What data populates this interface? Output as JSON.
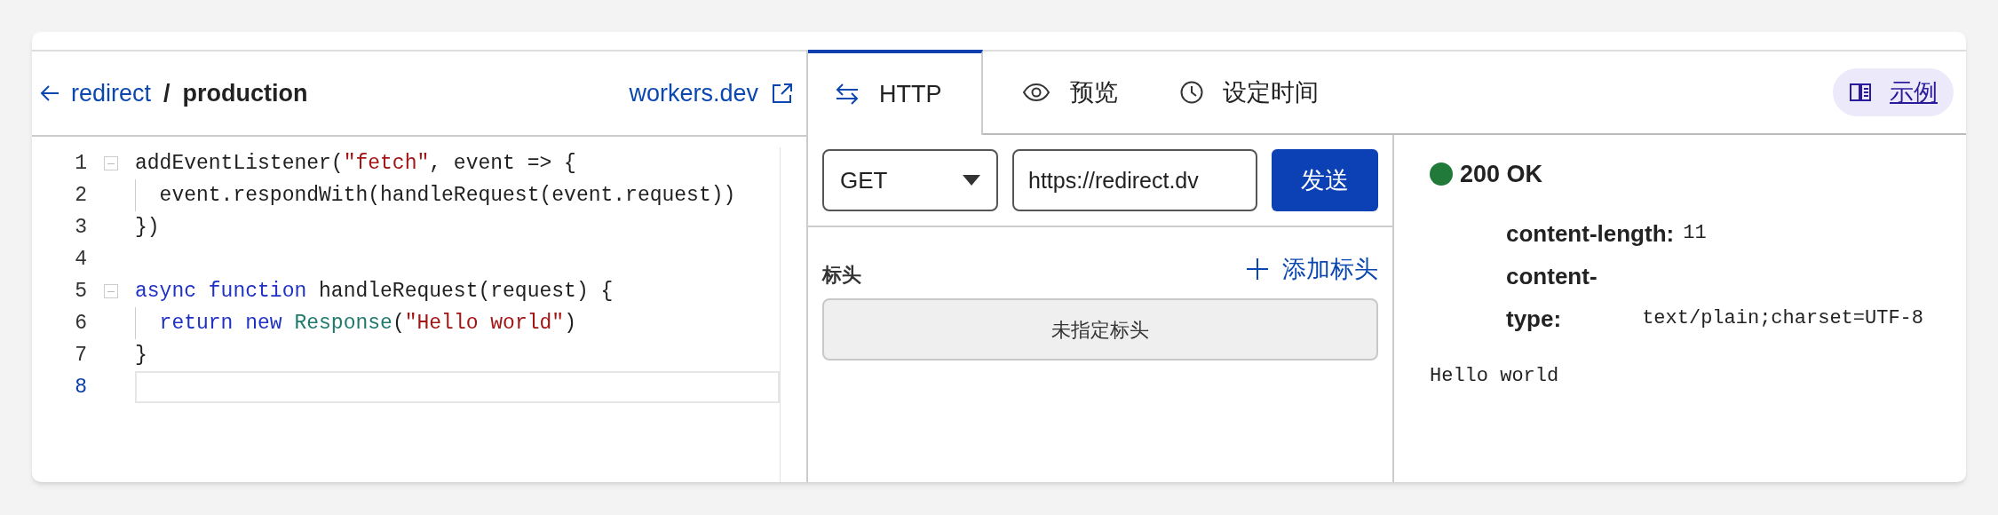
{
  "header": {
    "back_link": "redirect",
    "separator": "/",
    "environment": "production",
    "external_link": "workers.dev"
  },
  "editor": {
    "lines": [
      {
        "number": "1",
        "foldable": true,
        "current": false,
        "tokens": [
          {
            "text": "addEventListener(",
            "kind": "plain"
          },
          {
            "text": "\"fetch\"",
            "kind": "string"
          },
          {
            "text": ", event => {",
            "kind": "plain"
          }
        ]
      },
      {
        "number": "2",
        "foldable": false,
        "current": false,
        "tokens": [
          {
            "text": "  event.respondWith(handleRequest(event.request))",
            "kind": "plain"
          }
        ]
      },
      {
        "number": "3",
        "foldable": false,
        "current": false,
        "tokens": [
          {
            "text": "})",
            "kind": "plain"
          }
        ]
      },
      {
        "number": "4",
        "foldable": false,
        "current": false
      },
      {
        "number": "5",
        "foldable": true,
        "current": false,
        "tokens": [
          {
            "text": "async function",
            "kind": "keyword"
          },
          {
            "text": " handleRequest(request) {",
            "kind": "plain"
          }
        ]
      },
      {
        "number": "6",
        "foldable": false,
        "current": false,
        "tokens": [
          {
            "text": "  return new",
            "kind": "keyword"
          },
          {
            "text": " Response",
            "kind": "class"
          },
          {
            "text": "(",
            "kind": "plain"
          },
          {
            "text": "\"Hello world\"",
            "kind": "string"
          },
          {
            "text": ")",
            "kind": "plain"
          }
        ]
      },
      {
        "number": "7",
        "foldable": false,
        "current": false,
        "tokens": [
          {
            "text": "}",
            "kind": "plain"
          }
        ]
      },
      {
        "number": "8",
        "foldable": false,
        "current": true
      }
    ]
  },
  "tabs": [
    {
      "label": "HTTP",
      "selected": true
    },
    {
      "label": "预览",
      "selected": false
    },
    {
      "label": "设定时间",
      "selected": false
    }
  ],
  "examples_button": "示例",
  "request": {
    "method": "GET",
    "url": "https://redirect.dv",
    "send_button": "发送",
    "headers_label": "标头",
    "add_header_link": "添加标头",
    "empty_headers": "未指定标头"
  },
  "response": {
    "status": {
      "text": "200 OK",
      "color": "#217a3a"
    },
    "headers": [
      {
        "name": "content-length:",
        "value": "11"
      },
      {
        "name": "content-type:",
        "value": "text/plain;charset=UTF-8"
      }
    ],
    "body": "Hello world"
  }
}
